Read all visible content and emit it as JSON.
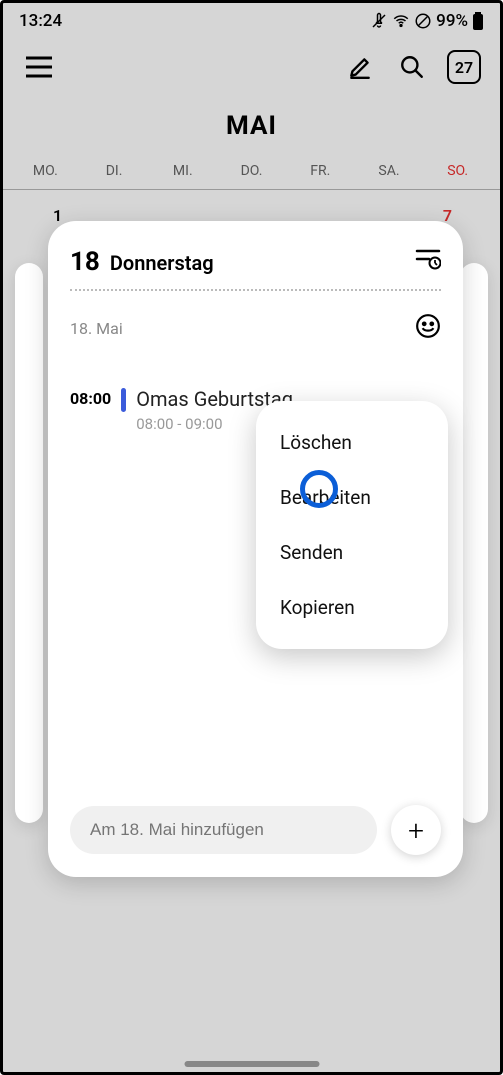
{
  "status": {
    "time": "13:24",
    "battery": "99%"
  },
  "toolbar": {
    "todayBadge": "27"
  },
  "month": {
    "title": "MAI"
  },
  "weekdays": [
    "MO.",
    "DI.",
    "MI.",
    "DO.",
    "FR.",
    "SA.",
    "SO."
  ],
  "bgDates": {
    "left": "1",
    "right": "7"
  },
  "day": {
    "num": "18",
    "name": "Donnerstag",
    "dateLabel": "18. Mai"
  },
  "event": {
    "startTime": "08:00",
    "title": "Omas Geburtstag",
    "timeRange": "08:00 - 09:00"
  },
  "addInput": {
    "placeholder": "Am 18. Mai hinzufügen"
  },
  "contextMenu": {
    "items": [
      "Löschen",
      "Bearbeiten",
      "Senden",
      "Kopieren"
    ]
  }
}
